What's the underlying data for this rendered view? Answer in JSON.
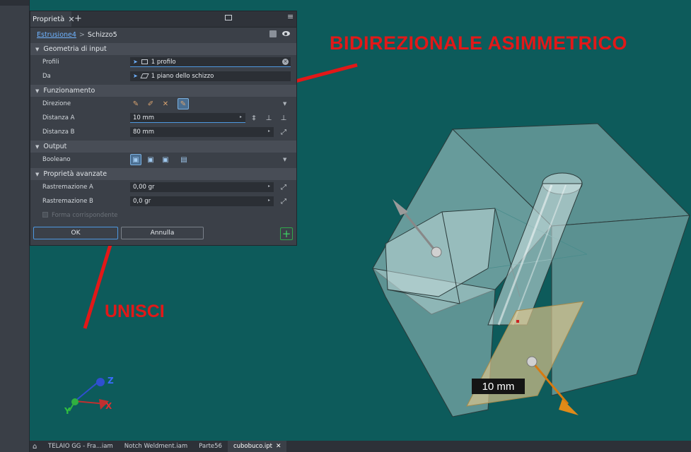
{
  "panel": {
    "tab_title": "Proprietà",
    "tab_close": "✕",
    "tab_add": "+",
    "breadcrumb": {
      "feature": "Estrusione4",
      "separator": ">",
      "sketch": "Schizzo5"
    },
    "sections": {
      "input": "Geometria di input",
      "behavior": "Funzionamento",
      "output": "Output",
      "advanced": "Proprietà avanzate"
    },
    "rows": {
      "profili_label": "Profili",
      "profili_value": "1 profilo",
      "da_label": "Da",
      "da_value": "1 piano dello schizzo",
      "direzione_label": "Direzione",
      "distanza_a_label": "Distanza A",
      "distanza_a_value": "10 mm",
      "distanza_b_label": "Distanza B",
      "distanza_b_value": "80 mm",
      "booleano_label": "Booleano",
      "rastremazione_a_label": "Rastremazione A",
      "rastremazione_a_value": "0,00 gr",
      "rastremazione_b_label": "Rastremazione B",
      "rastremazione_b_value": "0,0 gr",
      "forma_label": "Forma corrispondente"
    },
    "buttons": {
      "ok": "OK",
      "cancel": "Annulla"
    }
  },
  "annotations": {
    "direction_note": "BIDIREZIONALE ASIMMETRICO",
    "join_note": "UNISCI"
  },
  "viewport": {
    "dimension_label": "10 mm",
    "axes": {
      "x": "X",
      "y": "Y",
      "z": "Z"
    }
  },
  "taskbar": {
    "tabs": [
      "TELAIO GG - Fra...iam",
      "Notch Weldment.iam",
      "Parte56",
      "cubobuco.ipt"
    ],
    "active_index": 3,
    "close": "✕"
  },
  "colors": {
    "viewport_bg": "#0d5b5b",
    "annotation_red": "#e21818",
    "panel_bg": "#3b4048",
    "accent_blue": "#4e98e0"
  }
}
